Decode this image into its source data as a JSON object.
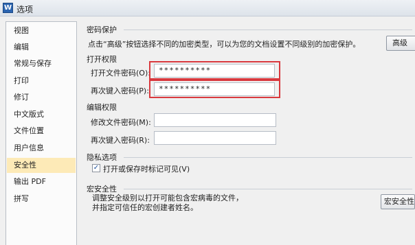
{
  "window": {
    "title": "选项",
    "icon_letter": "W"
  },
  "sidebar": {
    "items": [
      {
        "label": "视图"
      },
      {
        "label": "编辑"
      },
      {
        "label": "常规与保存"
      },
      {
        "label": "打印"
      },
      {
        "label": "修订"
      },
      {
        "label": "中文版式"
      },
      {
        "label": "文件位置"
      },
      {
        "label": "用户信息"
      },
      {
        "label": "安全性",
        "active": true
      },
      {
        "label": "输出 PDF"
      },
      {
        "label": "拼写"
      }
    ]
  },
  "password_protection": {
    "group_title": "密码保护",
    "description": "点击“高级”按钮选择不同的加密类型，可以为您的文档设置不同级别的加密保护。",
    "advanced_button": "高级",
    "open_permission": {
      "title": "打开权限",
      "password_label": "打开文件密码(O):",
      "password_value": "**********",
      "confirm_label": "再次键入密码(P):",
      "confirm_value": "**********"
    },
    "edit_permission": {
      "title": "编辑权限",
      "password_label": "修改文件密码(M):",
      "password_value": "",
      "confirm_label": "再次键入密码(R):",
      "confirm_value": ""
    }
  },
  "privacy": {
    "group_title": "隐私选项",
    "checkbox_label": "打开或保存时标记可见(V)",
    "checkbox_checked": true,
    "checkbox_glyph": "✓"
  },
  "macro_security": {
    "group_title": "宏安全性",
    "description_line1": "调整安全级别以打开可能包含宏病毒的文件，",
    "description_line2": "并指定可信任的宏创建者姓名。",
    "button_label": "宏安全性"
  },
  "colors": {
    "active_item": "#fdeab7",
    "highlight_border": "#d9393e"
  }
}
